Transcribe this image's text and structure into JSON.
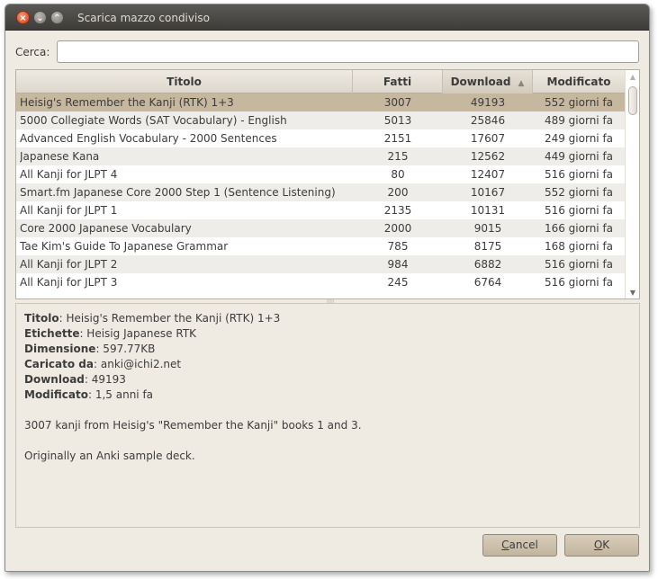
{
  "window": {
    "title": "Scarica mazzo condiviso"
  },
  "search": {
    "label": "Cerca:",
    "value": "",
    "placeholder": ""
  },
  "table": {
    "columns": [
      "Titolo",
      "Fatti",
      "Download",
      "Modificato"
    ],
    "sorted_column": "Download",
    "rows": [
      {
        "title": "Heisig's Remember the Kanji (RTK) 1+3",
        "facts": "3007",
        "downloads": "49193",
        "modified": "552 giorni fa"
      },
      {
        "title": "5000 Collegiate Words (SAT Vocabulary) - English",
        "facts": "5013",
        "downloads": "25846",
        "modified": "489 giorni fa"
      },
      {
        "title": "Advanced English Vocabulary - 2000 Sentences",
        "facts": "2151",
        "downloads": "17607",
        "modified": "249 giorni fa"
      },
      {
        "title": "Japanese Kana",
        "facts": "215",
        "downloads": "12562",
        "modified": "449 giorni fa"
      },
      {
        "title": "All Kanji for JLPT 4",
        "facts": "80",
        "downloads": "12407",
        "modified": "516 giorni fa"
      },
      {
        "title": "Smart.fm Japanese Core 2000 Step 1 (Sentence Listening)",
        "facts": "200",
        "downloads": "10167",
        "modified": "552 giorni fa"
      },
      {
        "title": "All Kanji for JLPT 1",
        "facts": "2135",
        "downloads": "10131",
        "modified": "516 giorni fa"
      },
      {
        "title": "Core 2000 Japanese Vocabulary",
        "facts": "2000",
        "downloads": "9015",
        "modified": "166 giorni fa"
      },
      {
        "title": "Tae Kim's Guide To Japanese Grammar",
        "facts": "785",
        "downloads": "8175",
        "modified": "168 giorni fa"
      },
      {
        "title": "All Kanji for JLPT 2",
        "facts": "984",
        "downloads": "6882",
        "modified": "516 giorni fa"
      },
      {
        "title": "All Kanji for JLPT 3",
        "facts": "245",
        "downloads": "6764",
        "modified": "516 giorni fa"
      }
    ]
  },
  "details": {
    "title_label": "Titolo",
    "title_value": ": Heisig's Remember the Kanji (RTK) 1+3",
    "tags_label": "Etichette",
    "tags_value": ": Heisig Japanese RTK",
    "size_label": "Dimensione",
    "size_value": ": 597.77KB",
    "uploader_label": "Caricato da",
    "uploader_value": ": anki@ichi2.net",
    "downloads_label": "Download",
    "downloads_value": ": 49193",
    "modified_label": "Modificato",
    "modified_value": ": 1,5 anni fa",
    "description_1": "3007 kanji from Heisig's \"Remember the Kanji\" books 1 and 3.",
    "description_2": "Originally an Anki sample deck."
  },
  "buttons": {
    "cancel_mnemonic": "C",
    "cancel_rest": "ancel",
    "ok_mnemonic": "O",
    "ok_rest": "K"
  },
  "icons": {
    "close": "close-icon",
    "minimize": "minimize-icon",
    "maximize": "maximize-icon",
    "sort": "sort-ascending-icon"
  },
  "colors": {
    "selection": "#c6b79f",
    "window_bg": "#f0ebe2",
    "titlebar": "#3d3c38"
  }
}
